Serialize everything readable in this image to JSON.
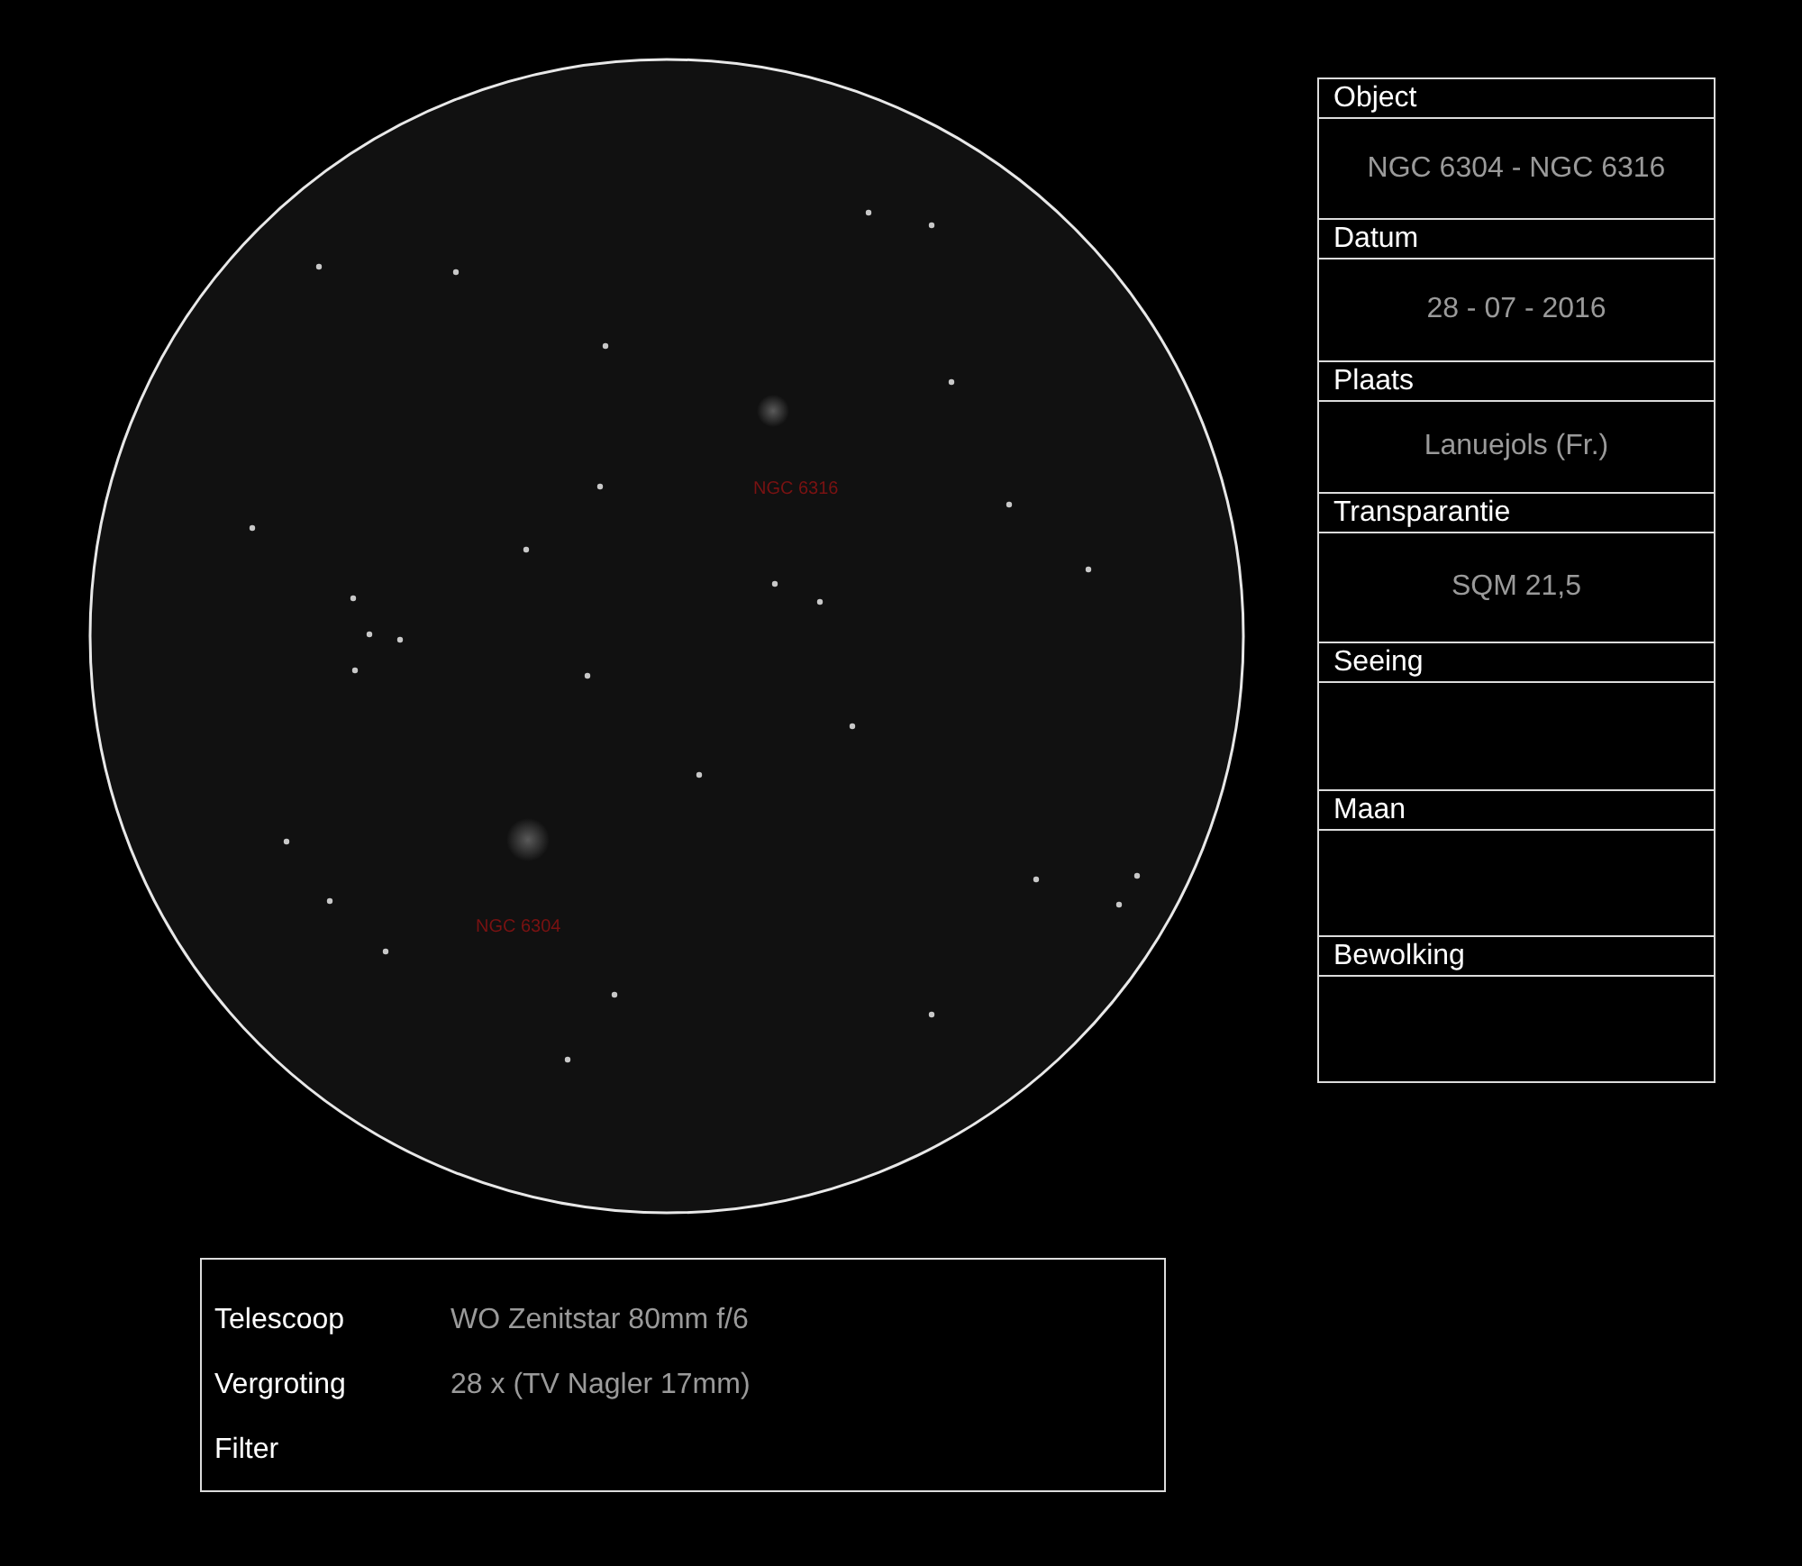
{
  "field_of_view": {
    "labels": [
      {
        "text": "NGC 6316"
      },
      {
        "text": "NGC 6304"
      }
    ]
  },
  "log": [
    {
      "label": "Object",
      "value": "NGC 6304 - NGC 6316"
    },
    {
      "label": "Datum",
      "value": "28 - 07 - 2016"
    },
    {
      "label": "Plaats",
      "value": "Lanuejols (Fr.)"
    },
    {
      "label": "Transparantie",
      "value": "SQM 21,5"
    },
    {
      "label": "Seeing"
    },
    {
      "label": "Maan"
    },
    {
      "label": "Bewolking"
    }
  ],
  "equipment": [
    {
      "label": "Telescoop",
      "value": "WO Zenitstar 80mm f/6"
    },
    {
      "label": "Vergroting",
      "value": "28 x (TV Nagler 17mm)"
    },
    {
      "label": "Filter"
    }
  ]
}
